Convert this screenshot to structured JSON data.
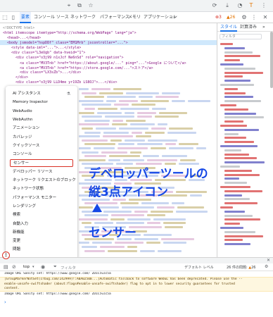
{
  "devtools": {
    "tabs": [
      "要素",
      "コンソール",
      "ソース",
      "ネットワーク",
      "パフォーマンス",
      "メモリ",
      "アプリケーション"
    ],
    "more_tabs": "»",
    "error_count": "3",
    "warning_count": "26",
    "styles_tabs": [
      "スタイル",
      "計算済み"
    ],
    "styles_more": "»",
    "filter_placeholder": "フィルタ"
  },
  "elements": {
    "lines": [
      "<!DOCTYPE html>",
      "<html itemscope itemtype=\"http://schema.org/WebPage\" lang=\"ja\">",
      "<head>...</head>",
      "<body jsmodel=\"hspDDf\" class=\"EM1Mrb\" jscontroller=\"...\">",
      "<style data-iml=\"...\">...</style>",
      "<div class=\"L3eUgb\" data-hveid=\"1\">",
      "<div class=\"o3j99 n1xJcf Ne6nSd\" role=\"navigation\">",
      "<a class=\"MV3Tnb\" href=\"https://about.google/...\" ping=\"...\">Google について</a>",
      "<a class=\"MV3Tnb\" href=\"https://store.google.com/...\">ストア</a>",
      "<div class=\"LX3sZb\">...</div>",
      "</div>",
      "<div class=\"o3j99 LLD4me yr19Zb LS8OJ\">...</div>"
    ]
  },
  "menu": {
    "items": [
      "AI アシスタンス",
      "Memory Inspector",
      "WebAudio",
      "WebAuthn",
      "アニメーション",
      "カバレッジ",
      "クイックソース",
      "コンソール",
      "センサー",
      "デベロッパー リソース",
      "ネットワーク リクエストのブロック",
      "ネットワーク状態",
      "パフォーマンス モニター",
      "レンダリング",
      "検索",
      "自動入力",
      "新機能",
      "変更",
      "問題"
    ],
    "highlighted_index": 8,
    "ai_icon": "flask-icon"
  },
  "annotation": {
    "line1": "デベロッパーツールの",
    "line2": "縦3点アイコン",
    "arrow": "▲",
    "line3": "センサー"
  },
  "console": {
    "context": "top",
    "filter_placeholder": "フィルタ",
    "levels": "デフォルト レベル",
    "issues": "26 件の問題:",
    "issues_count": "26",
    "messages": [
      "Image URL Sanity set: https://www.google.com/ ZD1C5vZc5a",
      "[GroupMarkerNotSet(crbug.com/242999)!:A0A02500...]Automatic fallback to software WebGL has been deprecated. Please use the --enable-unsafe-swiftshader (about:flags#enable-unsafe-swiftshader) flag to opt in to lower security guarantees for trusted content.",
      "Image URL Sanity set: https://www.google.com/ ZD1C5vZc5a"
    ]
  }
}
